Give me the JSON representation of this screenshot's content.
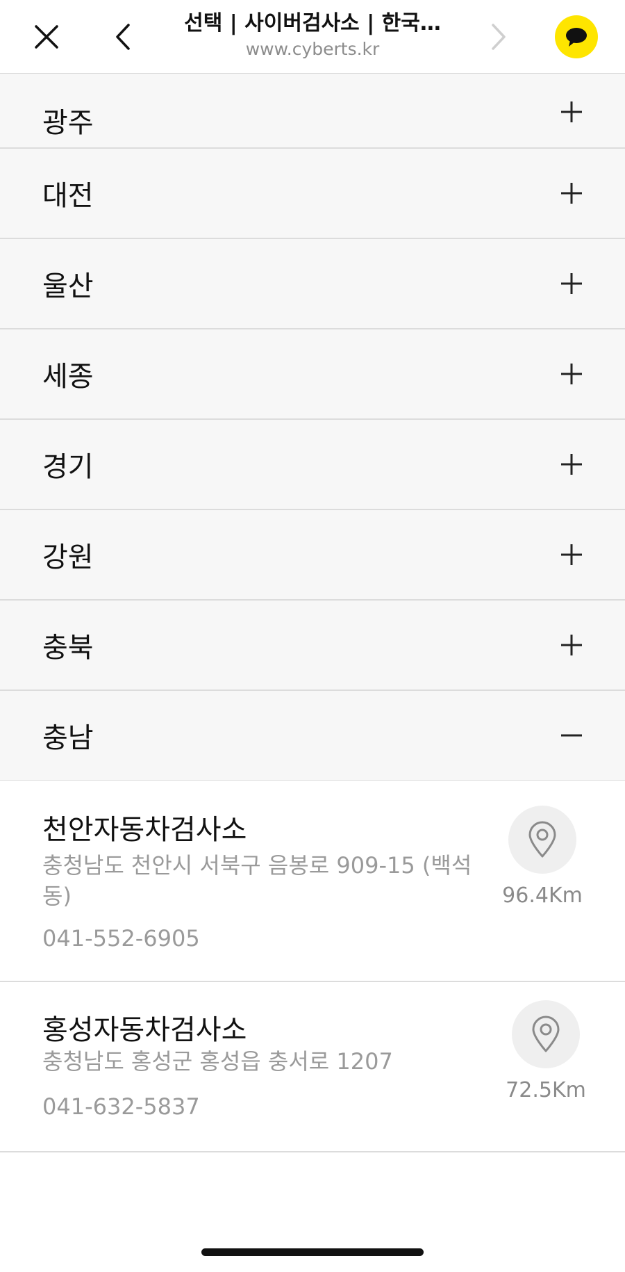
{
  "browser": {
    "title": "선택 | 사이버검사소 | 한국…",
    "url": "www.cyberts.kr",
    "accent": "#FEE500",
    "icons": {
      "close": "close-icon",
      "back": "chevron-left-icon",
      "forward": "chevron-right-icon",
      "chat": "kakaotalk-icon"
    }
  },
  "regions": [
    {
      "label": "광주",
      "expanded": false
    },
    {
      "label": "대전",
      "expanded": false
    },
    {
      "label": "울산",
      "expanded": false
    },
    {
      "label": "세종",
      "expanded": false
    },
    {
      "label": "경기",
      "expanded": false
    },
    {
      "label": "강원",
      "expanded": false
    },
    {
      "label": "충북",
      "expanded": false
    },
    {
      "label": "충남",
      "expanded": true
    }
  ],
  "stations": [
    {
      "name": "천안자동차검사소",
      "address": "충청남도 천안시 서북구 음봉로 909-15 (백석동)",
      "phone": "041-552-6905",
      "distance": "96.4Km"
    },
    {
      "name": "홍성자동차검사소",
      "address": "충청남도 홍성군 홍성읍 충서로 1207",
      "phone": "041-632-5837",
      "distance": "72.5Km"
    }
  ]
}
